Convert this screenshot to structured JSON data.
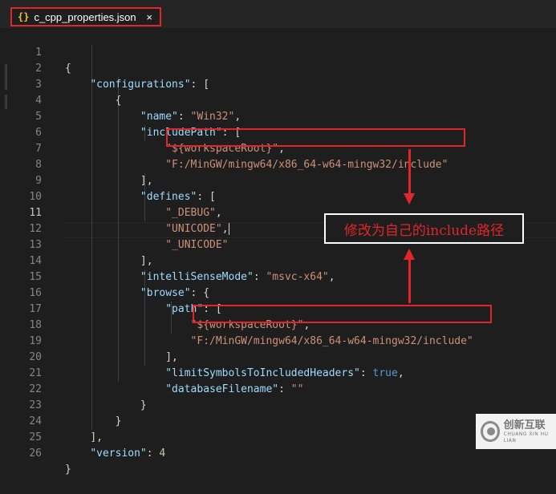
{
  "tab": {
    "icon": "{}",
    "filename": "c_cpp_properties.json",
    "close": "×"
  },
  "editor": {
    "active_line": 11,
    "lines": [
      {
        "num": "1"
      },
      {
        "num": "2"
      },
      {
        "num": "3"
      },
      {
        "num": "4"
      },
      {
        "num": "5"
      },
      {
        "num": "6"
      },
      {
        "num": "7"
      },
      {
        "num": "8"
      },
      {
        "num": "9"
      },
      {
        "num": "10"
      },
      {
        "num": "11"
      },
      {
        "num": "12"
      },
      {
        "num": "13"
      },
      {
        "num": "14"
      },
      {
        "num": "15"
      },
      {
        "num": "16"
      },
      {
        "num": "17"
      },
      {
        "num": "18"
      },
      {
        "num": "19"
      },
      {
        "num": "20"
      },
      {
        "num": "21"
      },
      {
        "num": "22"
      },
      {
        "num": "23"
      },
      {
        "num": "24"
      },
      {
        "num": "25"
      },
      {
        "num": "26"
      }
    ],
    "code": {
      "l1": "{",
      "l2_key": "\"configurations\"",
      "l2_rest": ": [",
      "l3": "{",
      "l4_key": "\"name\"",
      "l4_sep": ": ",
      "l4_val": "\"Win32\"",
      "l4_end": ",",
      "l5_key": "\"includePath\"",
      "l5_rest": ": [",
      "l6_val": "\"${workspaceRoot}\"",
      "l6_end": ",",
      "l7_val": "\"F:/MinGW/mingw64/x86_64-w64-mingw32/include\"",
      "l8": "],",
      "l9_key": "\"defines\"",
      "l9_rest": ": [",
      "l10_val": "\"_DEBUG\"",
      "l10_end": ",",
      "l11_val": "\"UNICODE\"",
      "l11_end": ",",
      "l12_val": "\"_UNICODE\"",
      "l13": "],",
      "l14_key": "\"intelliSenseMode\"",
      "l14_sep": ": ",
      "l14_val": "\"msvc-x64\"",
      "l14_end": ",",
      "l15_key": "\"browse\"",
      "l15_rest": ": {",
      "l16_key": "\"path\"",
      "l16_rest": ": [",
      "l17_val": "\"${workspaceRoot}\"",
      "l17_end": ",",
      "l18_val": "\"F:/MinGW/mingw64/x86_64-w64-mingw32/include\"",
      "l19": "],",
      "l20_key": "\"limitSymbolsToIncludedHeaders\"",
      "l20_sep": ": ",
      "l20_val": "true",
      "l20_end": ",",
      "l21_key": "\"databaseFilename\"",
      "l21_sep": ": ",
      "l21_val": "\"\"",
      "l22": "}",
      "l23": "}",
      "l24": "],",
      "l25_key": "\"version\"",
      "l25_sep": ": ",
      "l25_val": "4",
      "l26": "}"
    }
  },
  "annotation": {
    "text": "修改为自己的include路径"
  },
  "watermark": {
    "main": "创新互联",
    "sub": "CHUANG XIN HU LIAN"
  },
  "colors": {
    "background": "#1e1e1e",
    "key": "#9cdcfe",
    "string": "#ce9178",
    "number": "#b5cea8",
    "boolean": "#569cd6",
    "highlight": "#e0262a"
  }
}
